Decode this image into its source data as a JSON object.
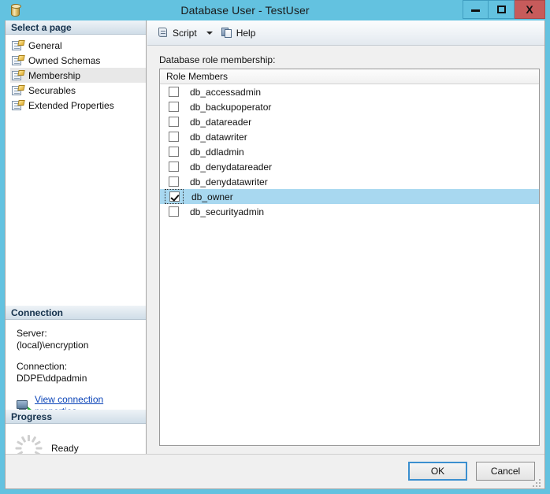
{
  "window": {
    "title": "Database User - TestUser",
    "icon": "database-cylinder-icon",
    "buttons": {
      "minimize": "minimize-icon",
      "maximize": "maximize-icon",
      "close": "X"
    },
    "frame_color": "#63c2e0",
    "close_color": "#c75b5b"
  },
  "sidebar": {
    "select_page_header": "Select a page",
    "items": [
      {
        "label": "General",
        "selected": false
      },
      {
        "label": "Owned Schemas",
        "selected": false
      },
      {
        "label": "Membership",
        "selected": true
      },
      {
        "label": "Securables",
        "selected": false
      },
      {
        "label": "Extended Properties",
        "selected": false
      }
    ],
    "connection": {
      "header": "Connection",
      "server_label": "Server:",
      "server_value": "(local)\\encryption",
      "connection_label": "Connection:",
      "connection_value": "DDPE\\ddpadmin",
      "link_text": "View connection properties",
      "link_color": "#0b44b8"
    },
    "progress": {
      "header": "Progress",
      "status": "Ready"
    }
  },
  "toolbar": {
    "script_label": "Script",
    "help_label": "Help"
  },
  "main": {
    "list_caption": "Database role membership:",
    "column_header": "Role Members",
    "selection_color": "#a8d8f0",
    "roles": [
      {
        "name": "db_accessadmin",
        "checked": false,
        "selected": false
      },
      {
        "name": "db_backupoperator",
        "checked": false,
        "selected": false
      },
      {
        "name": "db_datareader",
        "checked": false,
        "selected": false
      },
      {
        "name": "db_datawriter",
        "checked": false,
        "selected": false
      },
      {
        "name": "db_ddladmin",
        "checked": false,
        "selected": false
      },
      {
        "name": "db_denydatareader",
        "checked": false,
        "selected": false
      },
      {
        "name": "db_denydatawriter",
        "checked": false,
        "selected": false
      },
      {
        "name": "db_owner",
        "checked": true,
        "selected": true
      },
      {
        "name": "db_securityadmin",
        "checked": false,
        "selected": false
      }
    ]
  },
  "footer": {
    "ok_label": "OK",
    "cancel_label": "Cancel"
  }
}
